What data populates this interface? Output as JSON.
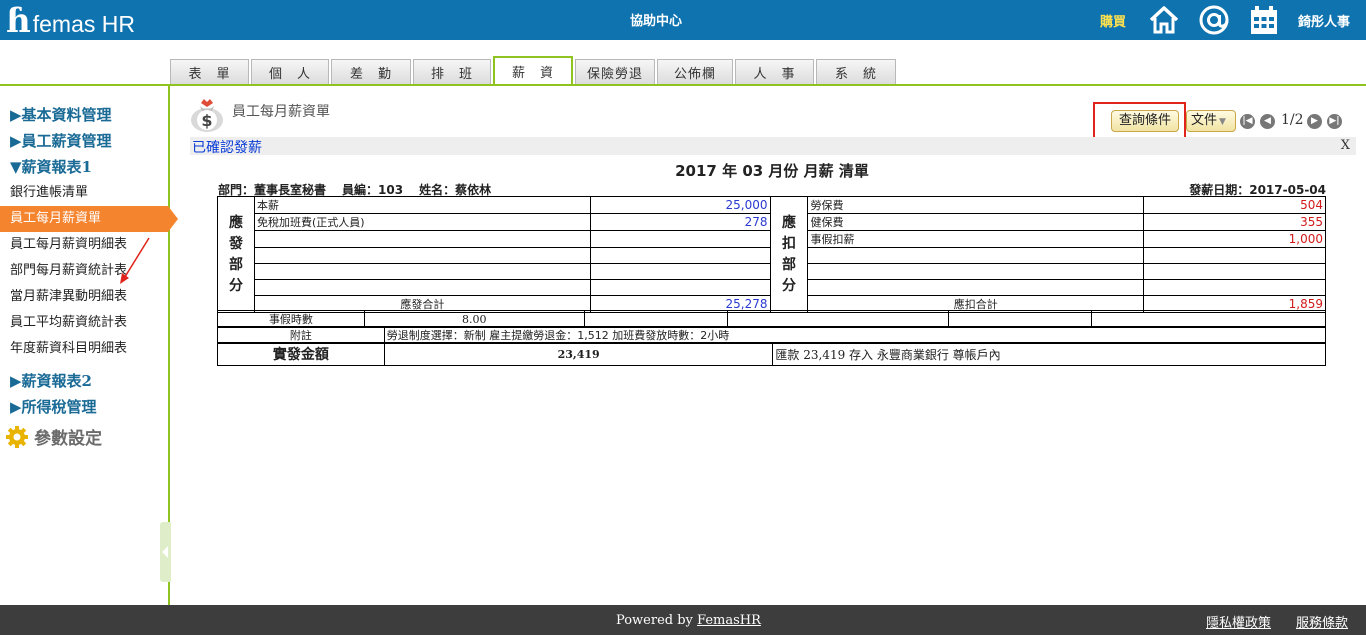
{
  "header": {
    "logo_mark": "ɦ",
    "brand": "femas HR",
    "help_center": "協助中心",
    "buy": "購買",
    "user_name": "錡彤人事",
    "bg_color": "#0f73b0",
    "icons": [
      "home-icon",
      "at-icon",
      "calendar-icon"
    ]
  },
  "tabs": [
    {
      "label": "表　單"
    },
    {
      "label": "個　人"
    },
    {
      "label": "差　勤"
    },
    {
      "label": "排　班"
    },
    {
      "label": "薪　資"
    },
    {
      "label": "保險勞退"
    },
    {
      "label": "公佈欄"
    },
    {
      "label": "人　事"
    },
    {
      "label": "系　統"
    }
  ],
  "sidebar": {
    "groups": [
      {
        "label": "▶基本資料管理"
      },
      {
        "label": "▶員工薪資管理"
      },
      {
        "label": "▼薪資報表1"
      },
      {
        "label": "▶薪資報表2"
      },
      {
        "label": "▶所得稅管理"
      }
    ],
    "items": [
      {
        "label": "銀行進帳清單"
      },
      {
        "label": "員工每月薪資單"
      },
      {
        "label": "員工每月薪資明細表"
      },
      {
        "label": "部門每月薪資統計表"
      },
      {
        "label": "當月薪津異動明細表"
      },
      {
        "label": "員工平均薪資統計表"
      },
      {
        "label": "年度薪資科目明細表"
      }
    ],
    "param_settings": "參數設定",
    "accent_color": "#f5842f"
  },
  "page": {
    "title": "員工每月薪資單",
    "query_button": "查詢條件",
    "doc_select": "文件",
    "pager": "1/2",
    "status": "已確認發薪",
    "close": "X"
  },
  "slip": {
    "title": "2017 年 03 月份 月薪 清單",
    "dept": "部門：董事長室秘書",
    "emp_no": "員編：103",
    "name": "姓名：蔡依林",
    "pay_date": "發薪日期：2017-05-04",
    "earn_label": "應\n發\n部\n分",
    "deduct_label": "應\n扣\n部\n分",
    "earnings": [
      {
        "item": "本薪",
        "amount": "25,000"
      },
      {
        "item": "免稅加班費(正式人員)",
        "amount": "278"
      },
      {
        "item": "",
        "amount": ""
      },
      {
        "item": "",
        "amount": ""
      },
      {
        "item": "",
        "amount": ""
      },
      {
        "item": "",
        "amount": ""
      }
    ],
    "deductions": [
      {
        "item": "勞保費",
        "amount": "504"
      },
      {
        "item": "健保費",
        "amount": "355"
      },
      {
        "item": "事假扣薪",
        "amount": "1,000"
      },
      {
        "item": "",
        "amount": ""
      },
      {
        "item": "",
        "amount": ""
      },
      {
        "item": "",
        "amount": ""
      }
    ],
    "earn_total_label": "應發合計",
    "earn_total": "25,278",
    "deduct_total_label": "應扣合計",
    "deduct_total": "1,859",
    "leave_hours_label": "事假時數",
    "leave_hours": "8.00",
    "note_label": "附註",
    "note_text": "勞退制度選擇：新制 雇主提繳勞退金：1,512 加班費發放時數：2小時",
    "net_label": "實發金額",
    "net_amount": "23,419",
    "remit_text": "匯款 23,419 存入 永豐商業銀行 尊帳戶內"
  },
  "footer": {
    "powered_prefix": "Powered by ",
    "powered_link": "FemasHR",
    "privacy": "隱私權政策",
    "terms": "服務條款"
  }
}
